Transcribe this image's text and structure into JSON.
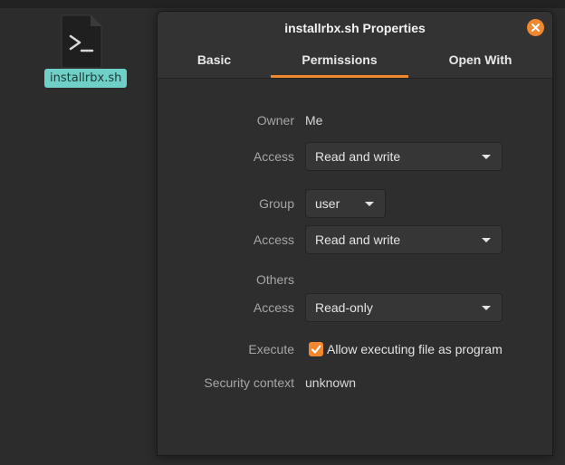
{
  "desktop": {
    "file_name": "installrbx.sh",
    "file_icon": "terminal-script-icon"
  },
  "dialog": {
    "title": "installrbx.sh Properties",
    "close_icon": "close-icon",
    "tabs": [
      {
        "label": "Basic",
        "active": false
      },
      {
        "label": "Permissions",
        "active": true
      },
      {
        "label": "Open With",
        "active": false
      }
    ],
    "owner": {
      "label": "Owner",
      "value": "Me"
    },
    "owner_access": {
      "label": "Access",
      "value": "Read and write"
    },
    "group": {
      "label": "Group",
      "value": "user"
    },
    "group_access": {
      "label": "Access",
      "value": "Read and write"
    },
    "others": {
      "label": "Others"
    },
    "others_access": {
      "label": "Access",
      "value": "Read-only"
    },
    "execute": {
      "label": "Execute",
      "checkbox_label": "Allow executing file as program",
      "checked": true
    },
    "security_context": {
      "label": "Security context",
      "value": "unknown"
    }
  },
  "colors": {
    "accent": "#f0882f",
    "selection": "#6fd0c8",
    "background": "#2e2e2e"
  }
}
